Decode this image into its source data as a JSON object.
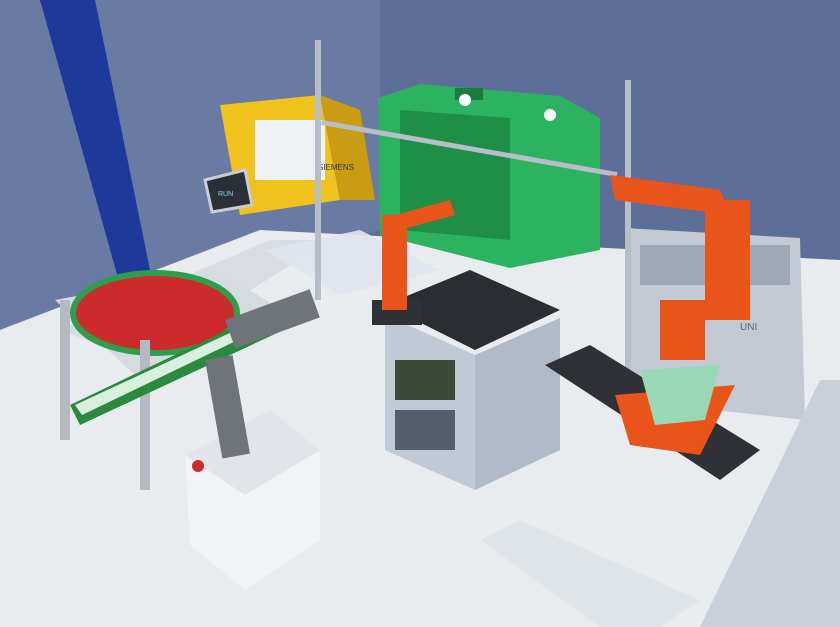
{
  "labels": {
    "machine_brand": "SIEMENS",
    "cnc_panel_text": "RUN",
    "cabinet_text": "UNI"
  },
  "colors": {
    "wall": "#5d6f98",
    "floor": "#e9ecef",
    "blue_stripe": "#1d3a9a",
    "green_machine": "#2bb35f",
    "orange_robot": "#e8541a",
    "red_table": "#cc2b2b",
    "yellow_machine": "#f0c21e",
    "conveyor_green": "#2b8a3e",
    "grey_frame": "#b8bec6"
  },
  "icons": [
    "robot-arm-icon",
    "conveyor-icon",
    "rotary-table-icon",
    "cnc-machine-icon"
  ]
}
